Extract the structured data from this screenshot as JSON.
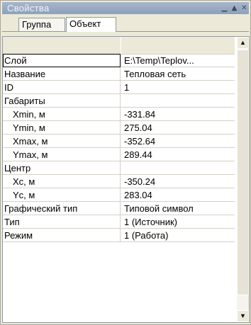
{
  "window": {
    "title": "Свойства",
    "min_icon": "minimize-icon",
    "restore_icon": "restore-icon",
    "close_icon": "close-icon"
  },
  "tabs": [
    {
      "label": "Группа",
      "active": false
    },
    {
      "label": "Объект",
      "active": true
    }
  ],
  "rows": [
    {
      "name": "Слой",
      "value": "E:\\Temp\\Teplov...",
      "indent": false
    },
    {
      "name": "Название",
      "value": "Тепловая сеть",
      "indent": false
    },
    {
      "name": "ID",
      "value": "1",
      "indent": false
    },
    {
      "name": "Габариты",
      "value": "",
      "indent": false
    },
    {
      "name": "Xmin, м",
      "value": "-331.84",
      "indent": true
    },
    {
      "name": "Ymin, м",
      "value": "275.04",
      "indent": true
    },
    {
      "name": "Xmax, м",
      "value": "-352.64",
      "indent": true
    },
    {
      "name": "Ymax, м",
      "value": "289.44",
      "indent": true
    },
    {
      "name": "Центр",
      "value": "",
      "indent": false
    },
    {
      "name": "Xc, м",
      "value": "-350.24",
      "indent": true
    },
    {
      "name": "Yc, м",
      "value": "283.04",
      "indent": true
    },
    {
      "name": "Графический тип",
      "value": "Типовой символ",
      "indent": false
    },
    {
      "name": "Тип",
      "value": "1 (Источник)",
      "indent": false
    },
    {
      "name": "Режим",
      "value": "1 (Работа)",
      "indent": false
    }
  ],
  "scrollbar": {
    "up_icon": "arrow-up-icon",
    "down_icon": "arrow-down-icon"
  }
}
